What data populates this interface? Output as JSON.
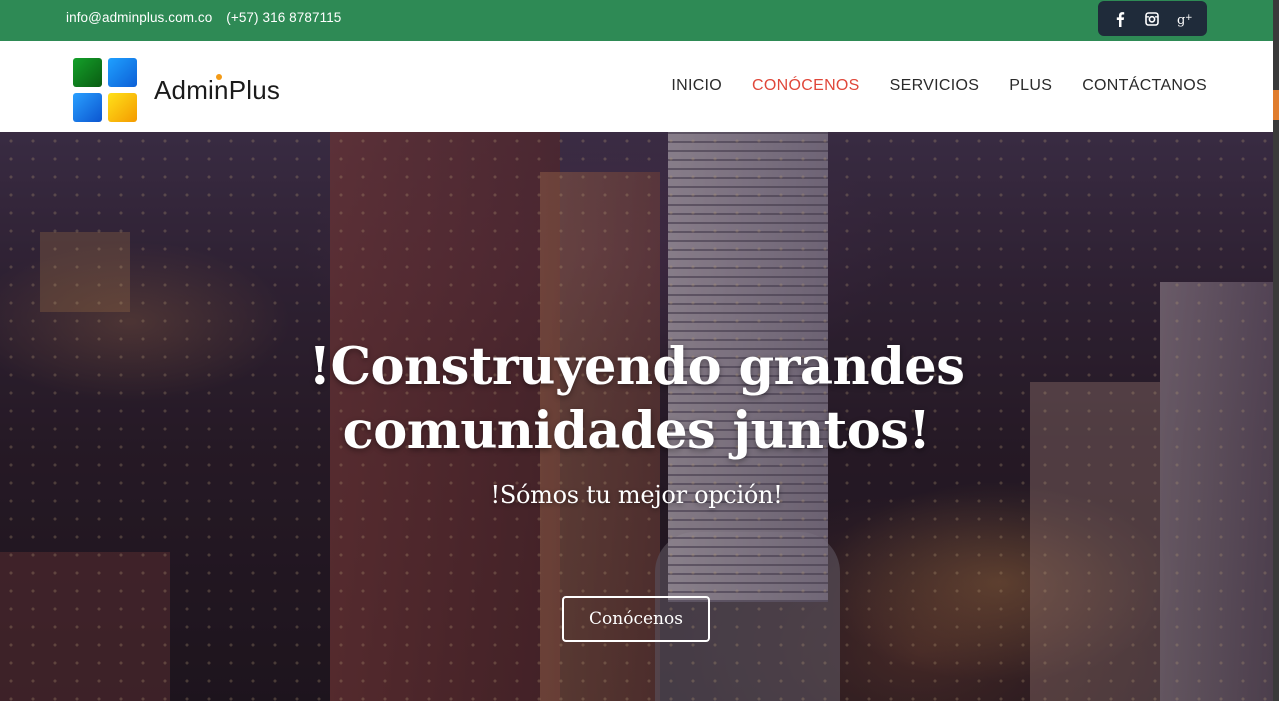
{
  "topbar": {
    "email": "info@adminplus.com.co",
    "phone": "(+57) 316 8787115",
    "social": [
      {
        "icon": "facebook-icon",
        "glyph": "f"
      },
      {
        "icon": "instagram-icon",
        "glyph": "◙"
      },
      {
        "icon": "google-plus-icon",
        "glyph": "g+"
      }
    ]
  },
  "brand": {
    "name": "AdminPlus",
    "accent": "#f39a16"
  },
  "nav": {
    "items": [
      {
        "label": "INICIO"
      },
      {
        "label": "CONÓCENOS",
        "active": true
      },
      {
        "label": "SERVICIOS"
      },
      {
        "label": "PLUS"
      },
      {
        "label": "CONTÁCTANOS"
      }
    ],
    "active_color": "#e0473a"
  },
  "hero": {
    "title": "!Construyendo grandes comunidades juntos!",
    "subtitle": "!Sómos tu mejor opción!",
    "cta_label": "Conócenos"
  },
  "colors": {
    "topbar_bg": "#2e8a55",
    "social_bg": "#1f2b3a"
  }
}
